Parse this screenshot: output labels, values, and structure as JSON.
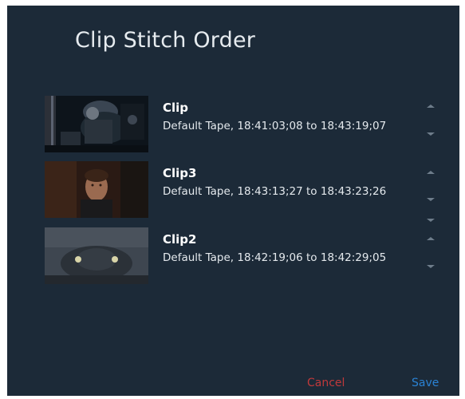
{
  "dialog": {
    "title": "Clip Stitch Order",
    "clips": [
      {
        "name": "Clip",
        "description": "Default Tape, 18:41:03;08 to 18:43:19;07"
      },
      {
        "name": "Clip3",
        "description": "Default Tape, 18:43:13;27 to 18:43:23;26"
      },
      {
        "name": "Clip2",
        "description": "Default Tape, 18:42:19;06 to 18:42:29;05"
      }
    ],
    "cancel_label": "Cancel",
    "save_label": "Save"
  },
  "colors": {
    "background": "#1c2a38",
    "cancel": "#c0393b",
    "save": "#2a82d4",
    "arrow": "#6e7d8b"
  }
}
